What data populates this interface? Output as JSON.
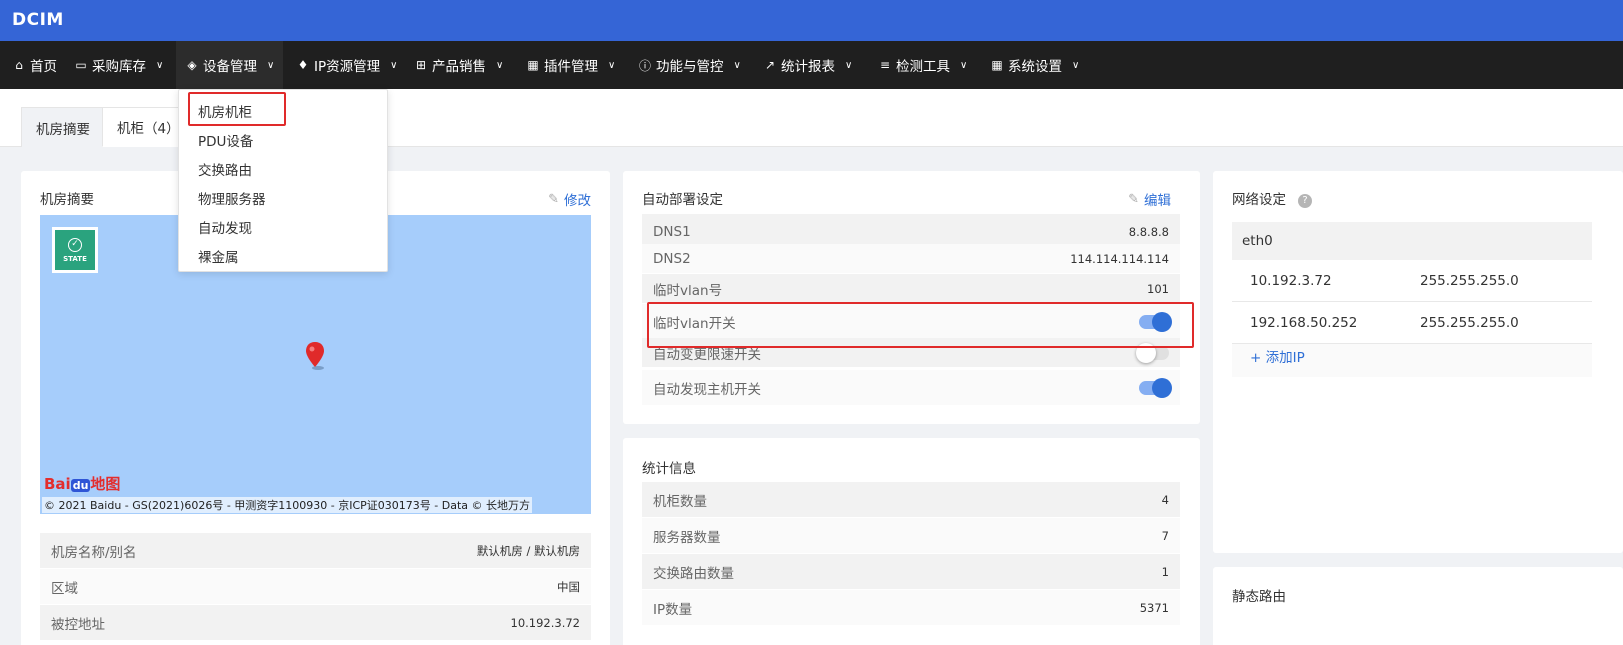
{
  "app": {
    "brand": "DCIM"
  },
  "nav": [
    {
      "label": "首页",
      "icon": "home-icon",
      "glyph": "⌂",
      "chevron": false
    },
    {
      "label": "采购库存",
      "icon": "inbox-icon",
      "glyph": "▭",
      "chevron": true
    },
    {
      "label": "设备管理",
      "icon": "cube-icon",
      "glyph": "◈",
      "chevron": true
    },
    {
      "label": "IP资源管理",
      "icon": "map-marker-icon",
      "glyph": "♦",
      "chevron": true
    },
    {
      "label": "产品销售",
      "icon": "cart-icon",
      "glyph": "⊞",
      "chevron": true
    },
    {
      "label": "插件管理",
      "icon": "table-icon",
      "glyph": "▦",
      "chevron": true
    },
    {
      "label": "功能与管控",
      "icon": "info-circle-icon",
      "glyph": "ⓘ",
      "chevron": true
    },
    {
      "label": "统计报表",
      "icon": "line-chart-icon",
      "glyph": "↗",
      "chevron": true
    },
    {
      "label": "检测工具",
      "icon": "list-icon",
      "glyph": "≡",
      "chevron": true
    },
    {
      "label": "系统设置",
      "icon": "grid-icon",
      "glyph": "▦",
      "chevron": true
    }
  ],
  "dropdown": {
    "items": [
      "机房机柜",
      "PDU设备",
      "交换路由",
      "物理服务器",
      "自动发现",
      "裸金属"
    ]
  },
  "tabs": [
    "机房摘要",
    "机柜（4）"
  ],
  "room_summary": {
    "title": "机房摘要",
    "edit_label": "修改",
    "map": {
      "state_label": "STATE",
      "logo_text": "Bai",
      "logo_du": "du",
      "logo_suffix": "地图",
      "copyright": "© 2021 Baidu - GS(2021)6026号 - 甲测资字1100930 - 京ICP证030173号 - Data © 长地万方"
    },
    "rows": [
      {
        "key": "机房名称/别名",
        "value": "默认机房 / 默认机房"
      },
      {
        "key": "区域",
        "value": "中国"
      },
      {
        "key": "被控地址",
        "value": "10.192.3.72"
      }
    ]
  },
  "auto_deploy": {
    "title": "自动部署设定",
    "edit_label": "编辑",
    "rows": [
      {
        "key": "DNS1",
        "value": "8.8.8.8"
      },
      {
        "key": "DNS2",
        "value": "114.114.114.114"
      },
      {
        "key": "临时vlan号",
        "value": "101"
      }
    ],
    "toggles": [
      {
        "key": "临时vlan开关",
        "on": true
      },
      {
        "key": "自动变更限速开关",
        "on": false
      },
      {
        "key": "自动发现主机开关",
        "on": true
      }
    ]
  },
  "stats": {
    "title": "统计信息",
    "rows": [
      {
        "key": "机柜数量",
        "value": "4"
      },
      {
        "key": "服务器数量",
        "value": "7"
      },
      {
        "key": "交换路由数量",
        "value": "1"
      },
      {
        "key": "IP数量",
        "value": "5371"
      }
    ]
  },
  "network": {
    "title": "网络设定",
    "help": "?",
    "interface": "eth0",
    "addresses": [
      {
        "ip": "10.192.3.72",
        "mask": "255.255.255.0"
      },
      {
        "ip": "192.168.50.252",
        "mask": "255.255.255.0"
      }
    ],
    "add_ip_label": "+ 添加IP"
  },
  "static_route": {
    "title": "静态路由"
  },
  "colors": {
    "brand_bar": "#3565d6",
    "nav_bar": "#1f1f1f",
    "accent": "#2f6fd6",
    "highlight": "#e02a2a",
    "map": "#a6cdfb",
    "state_badge": "#2aa37e"
  }
}
